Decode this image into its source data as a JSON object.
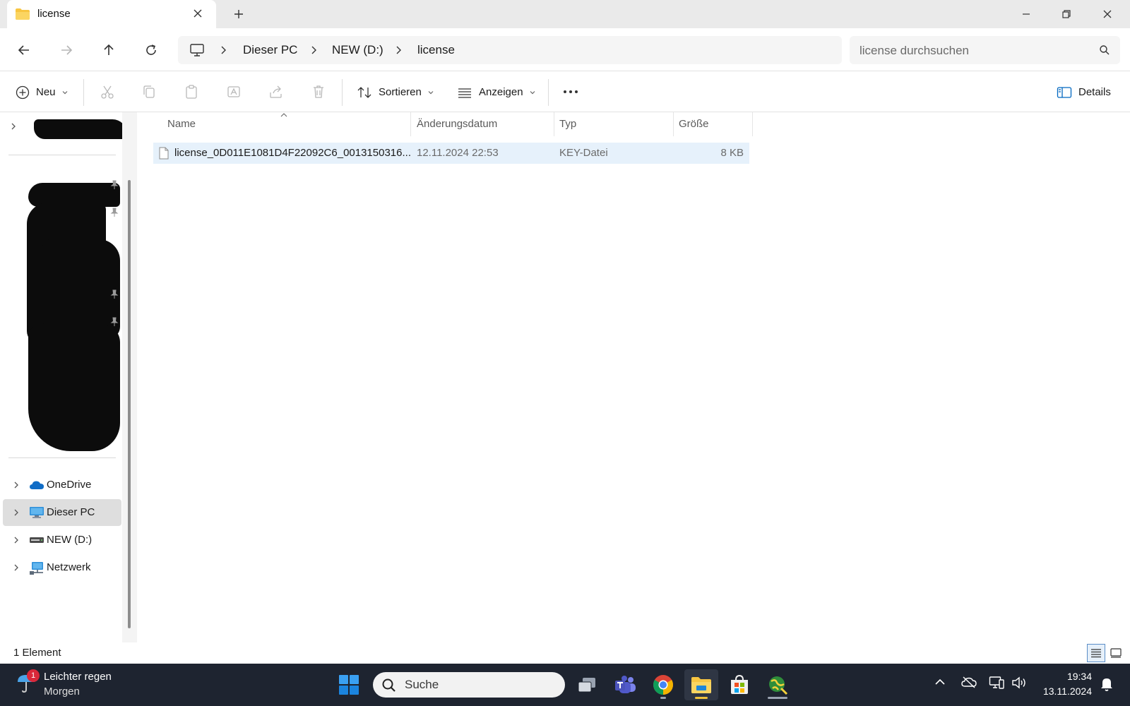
{
  "window": {
    "tab_title": "license",
    "new_tab_symbol": "+"
  },
  "address": {
    "crumbs": [
      "Dieser PC",
      "NEW (D:)",
      "license"
    ],
    "search_placeholder": "license durchsuchen"
  },
  "commands": {
    "new_label": "Neu",
    "sort_label": "Sortieren",
    "view_label": "Anzeigen",
    "details_label": "Details"
  },
  "sidebar": {
    "items": [
      {
        "label": "OneDrive",
        "icon": "cloud-icon"
      },
      {
        "label": "Dieser PC",
        "icon": "computer-icon"
      },
      {
        "label": "NEW (D:)",
        "icon": "drive-icon"
      },
      {
        "label": "Netzwerk",
        "icon": "network-icon"
      }
    ]
  },
  "filelist": {
    "columns": [
      "Name",
      "Änderungsdatum",
      "Typ",
      "Größe"
    ],
    "rows": [
      {
        "name": "license_0D011E1081D4F22092C6_0013150316...",
        "date": "12.11.2024 22:53",
        "type": "KEY-Datei",
        "size": "8 KB"
      }
    ]
  },
  "status": {
    "count": "1 Element"
  },
  "taskbar": {
    "weather_line1": "Leichter regen",
    "weather_line2": "Morgen",
    "weather_badge": "1",
    "search_label": "Suche",
    "time": "19:34",
    "date": "13.11.2024"
  },
  "colors": {
    "accent": "#0067c0",
    "selection": "#e6f1fb",
    "folder": "#f8c541",
    "taskbar": "#1e2430"
  }
}
